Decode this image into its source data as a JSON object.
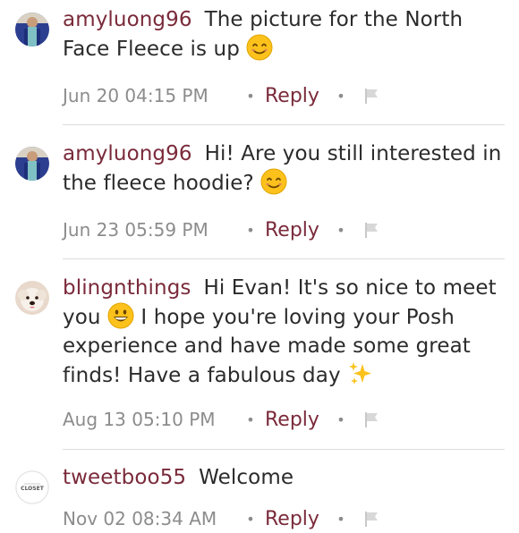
{
  "comments": [
    {
      "username": "amyluong96",
      "text_before": "The picture for the North Face Fleece is up",
      "emoji": "smile-emoji",
      "text_after": "",
      "timestamp": "Jun 20 04:15 PM",
      "reply_label": "Reply",
      "avatar": "user-photo-avatar"
    },
    {
      "username": "amyluong96",
      "text_before": "Hi! Are you still interested in the fleece hoodie?",
      "emoji": "smile-emoji",
      "text_after": "",
      "timestamp": "Jun 23 05:59 PM",
      "reply_label": "Reply",
      "avatar": "user-photo-avatar"
    },
    {
      "username": "blingnthings",
      "text_before": "Hi Evan! It's so nice to meet you",
      "emoji": "grin-emoji",
      "text_middle": "I hope you're loving your Posh experience and have made some great finds! Have a fabulous day",
      "emoji2": "sparkles-emoji",
      "timestamp": "Aug 13 05:10 PM",
      "reply_label": "Reply",
      "avatar": "dog-avatar"
    },
    {
      "username": "tweetboo55",
      "text_before": "Welcome",
      "timestamp": "Nov 02 08:34 AM",
      "reply_label": "Reply",
      "avatar": "closet-logo-avatar",
      "avatar_text": "CLOSET"
    }
  ],
  "colors": {
    "username": "#7a2a3a",
    "body_text": "#2b2b2b",
    "meta": "#8c8c8c",
    "divider": "#dcdcdc"
  }
}
